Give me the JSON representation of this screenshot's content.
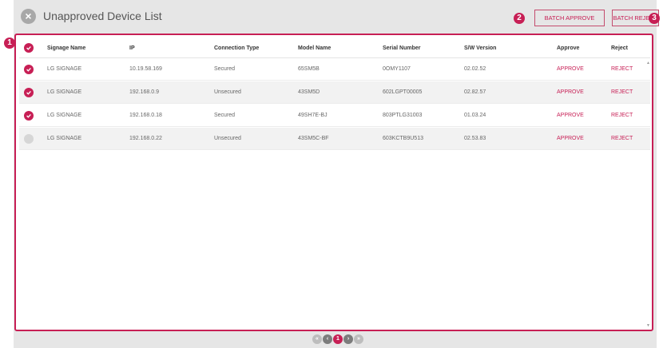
{
  "header": {
    "title": "Unapproved Device List",
    "close_icon": "close-icon",
    "batch_approve_label": "BATCH APPROVE",
    "batch_reject_label": "BATCH REJECT"
  },
  "callouts": [
    "1",
    "2",
    "3"
  ],
  "table": {
    "columns": [
      "Signage Name",
      "IP",
      "Connection Type",
      "Model Name",
      "Serial Number",
      "S/W Version",
      "Approve",
      "Reject"
    ],
    "rows": [
      {
        "checked": true,
        "name": "LG SIGNAGE",
        "ip": "10.19.58.169",
        "connection": "Secured",
        "model": "65SM5B",
        "serial": "0OMY1107",
        "sw": "02.02.52",
        "approve": "APPROVE",
        "reject": "REJECT"
      },
      {
        "checked": true,
        "name": "LG SIGNAGE",
        "ip": "192.168.0.9",
        "connection": "Unsecured",
        "model": "43SM5D",
        "serial": "602LGPT00005",
        "sw": "02.82.57",
        "approve": "APPROVE",
        "reject": "REJECT"
      },
      {
        "checked": true,
        "name": "LG SIGNAGE",
        "ip": "192.168.0.18",
        "connection": "Secured",
        "model": "49SH7E-BJ",
        "serial": "803PTLG31003",
        "sw": "01.03.24",
        "approve": "APPROVE",
        "reject": "REJECT"
      },
      {
        "checked": false,
        "name": "LG SIGNAGE",
        "ip": "192.168.0.22",
        "connection": "Unsecured",
        "model": "43SM5C-BF",
        "serial": "603KCTB9U513",
        "sw": "02.53.83",
        "approve": "APPROVE",
        "reject": "REJECT"
      }
    ]
  },
  "pagination": {
    "current_page": "1",
    "controls": [
      "first-page-icon",
      "prev-page-icon",
      "page-1",
      "next-page-icon",
      "last-page-icon"
    ]
  },
  "colors": {
    "accent": "#c71f55",
    "frame": "#e6e6e6"
  }
}
